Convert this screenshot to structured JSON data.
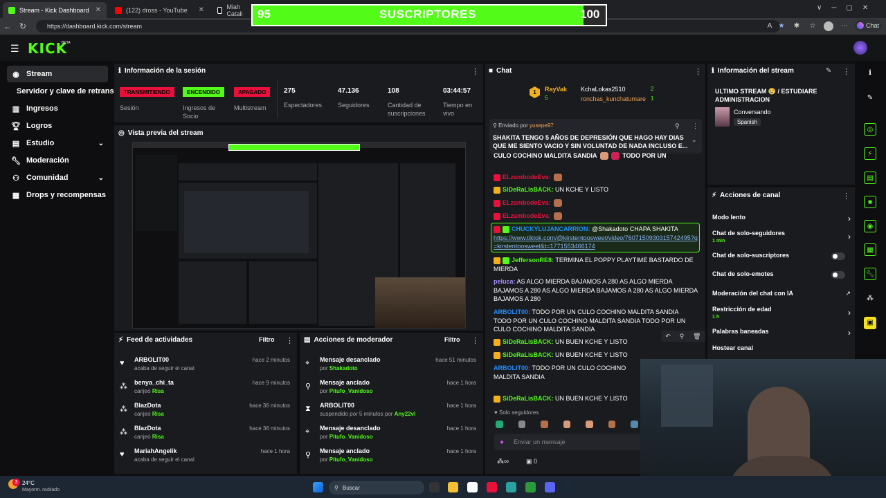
{
  "browser": {
    "tabs": [
      {
        "title": "Stream - Kick Dashboard",
        "color": "#53fc18"
      },
      {
        "title": "(122) dross - YouTube",
        "color": "#ff0000"
      },
      {
        "title": "Miah Catali",
        "color": "#ffffff"
      }
    ],
    "url": "https://dashboard.kick.com/stream",
    "chat_label": "Chat"
  },
  "sub_goal": {
    "current": "95",
    "label": "SUSCRIPTORES",
    "goal": "100",
    "progress": 0.95
  },
  "header": {
    "logo": "KICK",
    "beta": "BETA"
  },
  "sidebar": {
    "items": [
      {
        "label": "Stream",
        "icon": "stream-icon"
      },
      {
        "label": "Servidor y clave de retransm",
        "icon": ""
      },
      {
        "label": "Ingresos",
        "icon": "chart-icon"
      },
      {
        "label": "Logros",
        "icon": "trophy-icon"
      },
      {
        "label": "Estudio",
        "icon": "studio-icon"
      },
      {
        "label": "Moderación",
        "icon": "wrench-icon"
      },
      {
        "label": "Comunidad",
        "icon": "community-icon"
      },
      {
        "label": "Drops y recompensas",
        "icon": "drops-icon"
      }
    ]
  },
  "session": {
    "title": "Información de la sesión",
    "badges": [
      {
        "value": "TRANSMITIENDO",
        "label": "Sesión",
        "color": "#e9113c"
      },
      {
        "value": "ENCENDIDO",
        "label": "Ingresos de Socio",
        "color": "#53fc18"
      },
      {
        "value": "APAGADO",
        "label": "Multistream",
        "color": "#e9113c"
      }
    ],
    "stats": [
      {
        "value": "275",
        "label": "Espectadores"
      },
      {
        "value": "47.136",
        "label": "Seguidores"
      },
      {
        "value": "108",
        "label": "Cantidad de suscripciones"
      },
      {
        "value": "03:44:57",
        "label": "Tiempo en vivo"
      }
    ]
  },
  "preview": {
    "title": "Vista previa del stream"
  },
  "activity": {
    "title": "Feed de actividades",
    "filter": "Filtro",
    "rows": [
      {
        "name": "ARBOLIT00",
        "sub": "acaba de seguir el canal",
        "highlight": "",
        "time": "hace 2 minutos",
        "icon": "heart-icon"
      },
      {
        "name": "benya_chi_ta",
        "sub": "canjeó",
        "highlight": "Risa",
        "time": "hace 9 minutos",
        "icon": "redeem-icon"
      },
      {
        "name": "BlazDota",
        "sub": "canjeó",
        "highlight": "Risa",
        "time": "hace 36 minutos",
        "icon": "redeem-icon"
      },
      {
        "name": "BlazDota",
        "sub": "canjeó",
        "highlight": "Risa",
        "time": "hace 36 minutos",
        "icon": "redeem-icon"
      },
      {
        "name": "MariahAngelik",
        "sub": "acaba de seguir el canal",
        "highlight": "",
        "time": "hace 1 hora",
        "icon": "heart-icon"
      }
    ]
  },
  "modactions": {
    "title": "Acciones de moderador",
    "filter": "Filtro",
    "rows": [
      {
        "name": "Mensaje desanclado",
        "sub": "por",
        "highlight": "Shakadoto",
        "time": "hace 51 minutos",
        "icon": "unpin-icon"
      },
      {
        "name": "Mensaje anclado",
        "sub": "por",
        "highlight": "Pitufo_Vanidoso",
        "time": "hace 1 hora",
        "icon": "pin-icon"
      },
      {
        "name": "ARBOLIT00",
        "sub": "suspendido por 5 minutos por",
        "highlight": "Any22vl",
        "time": "hace 1 hora",
        "icon": "hourglass-icon"
      },
      {
        "name": "Mensaje desanclado",
        "sub": "por",
        "highlight": "Pitufo_Vanidoso",
        "time": "hace 1 hora",
        "icon": "unpin-icon"
      },
      {
        "name": "Mensaje anclado",
        "sub": "por",
        "highlight": "Pitufo_Vanidoso",
        "time": "hace 1 hora",
        "icon": "pin-icon"
      }
    ]
  },
  "chat": {
    "title": "Chat",
    "top": {
      "user1": "RayVak",
      "user1_count": "5",
      "user2": "KchaLokas2510",
      "user2_count": "2",
      "user3": "ronchas_kunchatumare",
      "user3_count": "1"
    },
    "pinned": {
      "by_label": "Enviado por",
      "by": "yusepe97",
      "text": "SHAKITA TENGO 5 AÑOS DE DEPRESIÓN QUE HAGO HAY DIAS QUE ME SIENTO VACIO Y SIN VOLUNTAD DE NADA INCLUSO E..."
    },
    "messages": [
      {
        "user": "",
        "text": "CULO COCHINO MALDITA SANDIA",
        "color": "#ffffff",
        "tail": "TODO POR UN"
      },
      {
        "user": "ELzambodeEva:",
        "text": "",
        "color": "#e9113c"
      },
      {
        "user": "SiDeRaLisBACK:",
        "text": "UN KCHE Y LISTO",
        "color": "#53fc18"
      },
      {
        "user": "ELzambodeEva:",
        "text": "",
        "color": "#e9113c"
      },
      {
        "user": "ELzambodeEva:",
        "text": "",
        "color": "#e9113c"
      },
      {
        "user": "CHUCKYLUJANCARRION:",
        "text": "@Shakadoto CHAPA SHAKITA",
        "color": "#1e90ff",
        "link": "https://www.tiktok.com/@kirstentoosweet/video/7607150930315742495?q=kirstentoosweet&t=1771553466174"
      },
      {
        "user": "JeffersonRE8:",
        "text": "TERMINA EL POPPY PLAYTIME BASTARDO DE MIERDA",
        "color": "#53fc18"
      },
      {
        "user": "peluca:",
        "text": "AS ALGO MIERDA BAJAMOS A 280 AS ALGO MIERDA BAJAMOS A 280 AS ALGO MIERDA BAJAMOS A 280 AS ALGO MIERDA BAJAMOS A 280",
        "color": "#a58cff"
      },
      {
        "user": "ARBOLIT00:",
        "text": "TODO POR UN CULO COCHINO MALDITA SANDIA TODO POR UN CULO COCHINO MALDITA SANDIA TODO POR UN CULO COCHINO MALDITA SANDIA",
        "color": "#1e90ff"
      },
      {
        "user": "SiDeRaLisBACK:",
        "text": "UN BUEN KCHE Y LISTO",
        "color": "#53fc18"
      },
      {
        "user": "SiDeRaLisBACK:",
        "text": "UN BUEN KCHE Y LISTO",
        "color": "#53fc18"
      },
      {
        "user": "ARBOLIT00:",
        "text": "TODO POR UN CULO COCHINO MALDITA SANDIA",
        "color": "#1e90ff"
      },
      {
        "user": "SiDeRaLisBACK:",
        "text": "UN BUEN KCHE Y LISTO",
        "color": "#53fc18"
      }
    ],
    "followers_only": "Solo seguidores",
    "input_placeholder": "Enviar un mensaje",
    "footer_count": "0"
  },
  "streaminfo": {
    "title": "Información del stream",
    "stream_title": "ULTIMO STREAM 😢 / ESTUDIARE ADMINISTRACION",
    "category": "Conversando",
    "language": "Spanish"
  },
  "channel_actions": {
    "title": "Acciones de canal",
    "items": [
      {
        "label": "Modo lento",
        "sub": "",
        "control": "chevron"
      },
      {
        "label": "Chat de solo-seguidores",
        "sub": "1 min",
        "control": "chevron"
      },
      {
        "label": "Chat de solo-suscriptores",
        "sub": "",
        "control": "toggle"
      },
      {
        "label": "Chat de solo-emotes",
        "sub": "",
        "control": "toggle"
      },
      {
        "label": "Moderación del chat con IA",
        "sub": "",
        "control": "external"
      },
      {
        "label": "Restricción de edad",
        "sub": "1 h",
        "control": "chevron"
      },
      {
        "label": "Palabras baneadas",
        "sub": "",
        "control": "chevron"
      },
      {
        "label": "Hostear canal",
        "sub": "",
        "control": "none"
      }
    ]
  },
  "taskbar": {
    "weather_temp": "24°C",
    "weather_desc": "Mayorm. nublado",
    "search": "Buscar",
    "notif": "3"
  }
}
